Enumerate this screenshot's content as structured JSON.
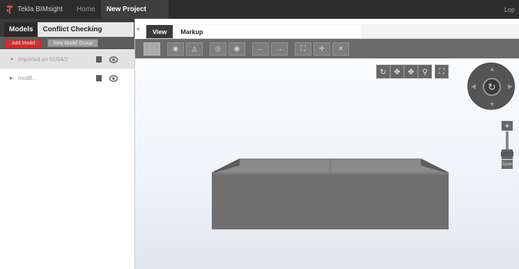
{
  "titlebar": {
    "app_name": "Tekla BIMsight",
    "tabs": [
      {
        "label": "Home"
      },
      {
        "label": "New Project"
      }
    ],
    "right_label": "Lop"
  },
  "left_panel": {
    "tabs": [
      {
        "label": "Models"
      },
      {
        "label": "Conflict Checking"
      }
    ],
    "toolbar": {
      "add_button": "Add Model",
      "group_button": "New Model Group"
    },
    "tree": [
      {
        "label": "Imported on 01/04/2",
        "expanded": true
      },
      {
        "label": "mod8...",
        "expanded": false
      }
    ]
  },
  "right_panel": {
    "tabs": [
      {
        "label": "View"
      },
      {
        "label": "Markup"
      }
    ]
  },
  "colors": {
    "titlebar_bg": "#2c2c2c",
    "toolbar_bg": "#6b6b6b",
    "highlight_red": "#e22020",
    "object_gray": "#6f6f6f"
  },
  "icons": {
    "toolbar": [
      "select-icon",
      "visibility-icon",
      "hide-icon",
      "show-all-icon",
      "ghost-icon",
      "back-icon",
      "forward-icon",
      "fit-all-icon",
      "measure-icon",
      "clip-icon"
    ],
    "view": [
      "rotate-icon",
      "pan-icon",
      "move-icon",
      "walk-icon",
      "fit-view-icon"
    ]
  },
  "navigation": {
    "zoom_label": "Zoom"
  }
}
